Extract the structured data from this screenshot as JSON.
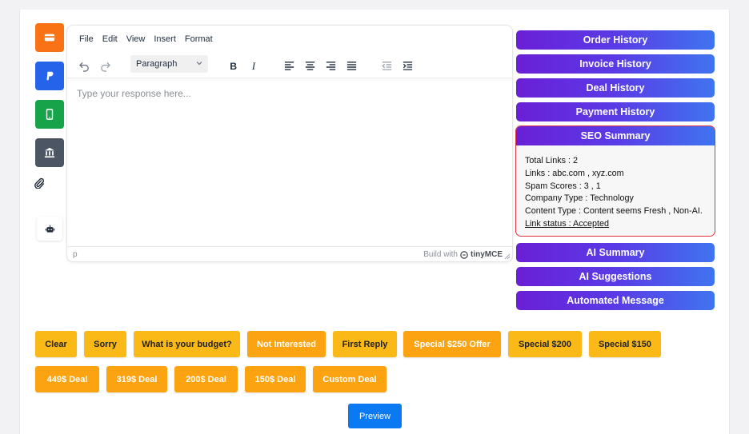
{
  "side_actions": [
    {
      "icon": "card-icon",
      "color": "#f97316"
    },
    {
      "icon": "paypal-icon",
      "color": "#2563eb"
    },
    {
      "icon": "mobile-icon",
      "color": "#16a34a"
    },
    {
      "icon": "bank-icon",
      "color": "#4b5563"
    },
    {
      "icon": "paperclip-icon"
    },
    {
      "icon": "robot-icon"
    }
  ],
  "editor": {
    "menu": [
      "File",
      "Edit",
      "View",
      "Insert",
      "Format"
    ],
    "block_format": "Paragraph",
    "placeholder": "Type your response here...",
    "status_path": "p",
    "brand_prefix": "Build with",
    "brand_name": "tinyMCE"
  },
  "right_panel": {
    "buttons_top": [
      "Order History",
      "Invoice History",
      "Deal History",
      "Payment History"
    ],
    "seo": {
      "title": "SEO Summary",
      "total_links": "Total Links : 2",
      "links": "Links : abc.com , xyz.com",
      "spam_scores": "Spam Scores : 3 , 1",
      "company_type": "Company Type : Technology",
      "content_type": "Content Type : Content seems Fresh , Non-AI.",
      "link_status": "Link status : Accepted"
    },
    "buttons_bottom": [
      "AI Summary",
      "AI Suggestions",
      "Automated Message"
    ]
  },
  "quick_replies_row1": [
    "Clear",
    "Sorry",
    "What is your budget?",
    "Not Interested",
    "First Reply",
    "Special $250 Offer",
    "Special $200",
    "Special $150"
  ],
  "quick_replies_row2": [
    "449$ Deal",
    "319$ Deal",
    "200$ Deal",
    "150$ Deal",
    "Custom Deal"
  ],
  "preview_label": "Preview",
  "colors": {
    "accent_yellow": "#fbb917",
    "accent_orange": "#fca311",
    "gradient_start": "#6a1fd6",
    "gradient_end": "#3f74f0",
    "seo_border": "#e0343f",
    "preview_blue": "#0b79f2"
  }
}
